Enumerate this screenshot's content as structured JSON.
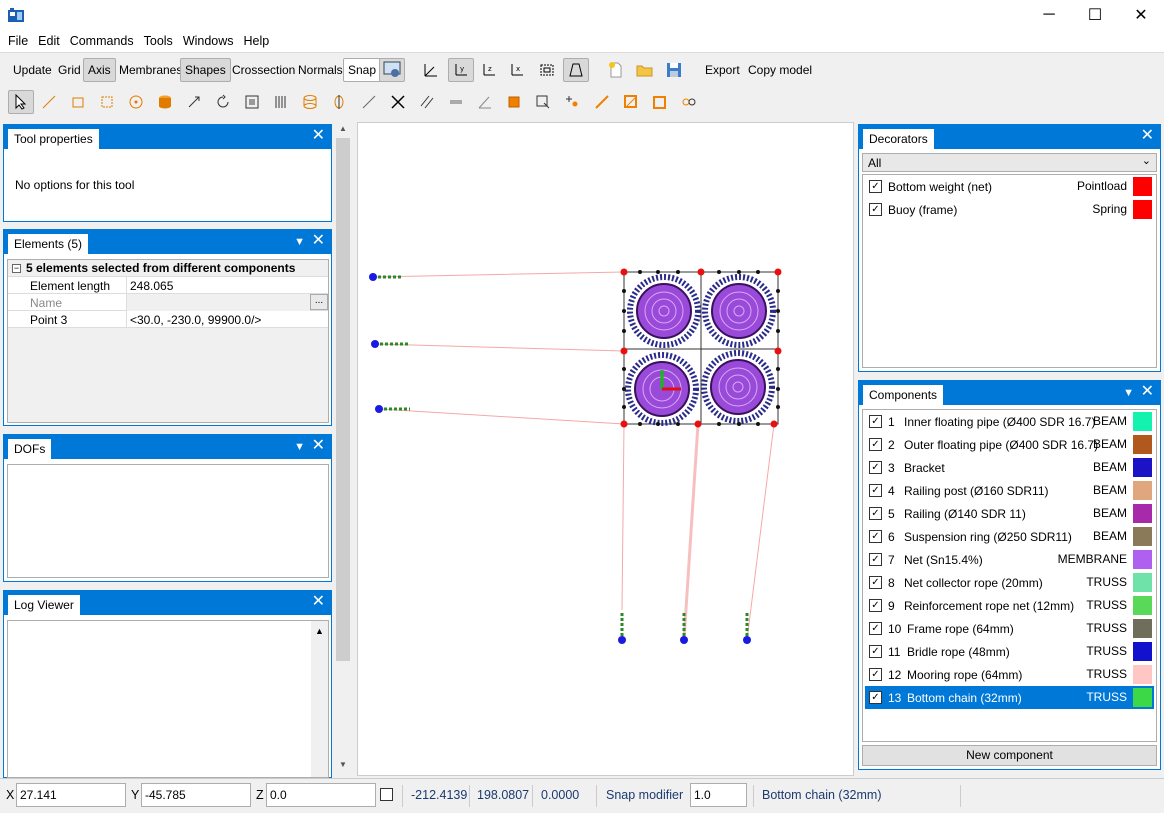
{
  "window": {
    "minimize": "─",
    "maximize": "☐",
    "close": "✕"
  },
  "menu": [
    "File",
    "Edit",
    "Commands",
    "Tools",
    "Windows",
    "Help"
  ],
  "toolbar": {
    "update": "Update",
    "grid": "Grid",
    "axis": "Axis",
    "membranes": "Membranes",
    "shapes": "Shapes",
    "crossection": "Crossection",
    "normals": "Normals",
    "snap": "Snap",
    "export": "Export",
    "copy_model": "Copy model"
  },
  "tool_properties": {
    "title": "Tool properties",
    "message": "No options for this tool"
  },
  "elements": {
    "title": "Elements (5)",
    "group": "5 elements selected from different components",
    "props": [
      {
        "name": "Element length",
        "value": "248.065"
      },
      {
        "name": "Name",
        "value": ""
      },
      {
        "name": "Point 3",
        "value": "<30.0, -230.0, 99900.0/>"
      }
    ],
    "ellipsis": "..."
  },
  "dofs": {
    "title": "DOFs"
  },
  "log": {
    "title": "Log Viewer"
  },
  "decorators": {
    "title": "Decorators",
    "filter": "All",
    "items": [
      {
        "label": "Bottom weight (net)",
        "type": "Pointload",
        "color": "#ff0000"
      },
      {
        "label": "Buoy (frame)",
        "type": "Spring",
        "color": "#ff0000"
      }
    ]
  },
  "components": {
    "title": "Components",
    "items": [
      {
        "num": "1",
        "label": "Inner floating pipe (Ø400 SDR 16.7)",
        "type": "BEAM",
        "color": "#14f2b0"
      },
      {
        "num": "2",
        "label": "Outer floating pipe (Ø400 SDR 16.7)",
        "type": "BEAM",
        "color": "#b0581e"
      },
      {
        "num": "3",
        "label": "Bracket",
        "type": "BEAM",
        "color": "#1c12c6"
      },
      {
        "num": "4",
        "label": "Railing post (Ø160 SDR11)",
        "type": "BEAM",
        "color": "#e0a67e"
      },
      {
        "num": "5",
        "label": "Railing (Ø140 SDR 11)",
        "type": "BEAM",
        "color": "#a62aaa"
      },
      {
        "num": "6",
        "label": "Suspension ring (Ø250 SDR11)",
        "type": "BEAM",
        "color": "#8a7a5a"
      },
      {
        "num": "7",
        "label": "Net (Sn15.4%)",
        "type": "MEMBRANE",
        "color": "#b060f0"
      },
      {
        "num": "8",
        "label": "Net collector rope (20mm)",
        "type": "TRUSS",
        "color": "#6ee2a8"
      },
      {
        "num": "9",
        "label": "Reinforcement rope net (12mm)",
        "type": "TRUSS",
        "color": "#5ad858"
      },
      {
        "num": "10",
        "label": "Frame rope (64mm)",
        "type": "TRUSS",
        "color": "#6e6e5a"
      },
      {
        "num": "11",
        "label": "Bridle rope (48mm)",
        "type": "TRUSS",
        "color": "#1212cc"
      },
      {
        "num": "12",
        "label": "Mooring rope (64mm)",
        "type": "TRUSS",
        "color": "#ffc6c6"
      },
      {
        "num": "13",
        "label": "Bottom chain (32mm)",
        "type": "TRUSS",
        "color": "#3cd848",
        "selected": true
      }
    ],
    "new_button": "New component"
  },
  "status": {
    "x_label": "X",
    "x": "27.141",
    "y_label": "Y",
    "y": "-45.785",
    "z_label": "Z",
    "z": "0.0",
    "c1": "-212.4139",
    "c2": "198.0807",
    "c3": "0.0000",
    "snap_label": "Snap modifier",
    "snap": "1.0",
    "current": "Bottom chain (32mm)"
  }
}
